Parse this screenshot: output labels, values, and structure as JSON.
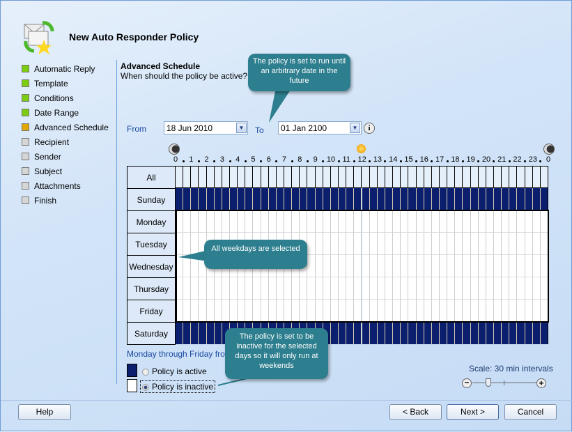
{
  "window": {
    "title": "New Auto Responder Policy"
  },
  "sidebar": {
    "items": [
      {
        "label": "Automatic Reply",
        "status": "complete"
      },
      {
        "label": "Template",
        "status": "complete"
      },
      {
        "label": "Conditions",
        "status": "complete"
      },
      {
        "label": "Date Range",
        "status": "complete"
      },
      {
        "label": "Advanced Schedule",
        "status": "current"
      },
      {
        "label": "Recipient",
        "status": "pending"
      },
      {
        "label": "Sender",
        "status": "pending"
      },
      {
        "label": "Subject",
        "status": "pending"
      },
      {
        "label": "Attachments",
        "status": "pending"
      },
      {
        "label": "Finish",
        "status": "pending"
      }
    ]
  },
  "status_colors": {
    "complete": "#7ccc10",
    "current": "#e0a800",
    "pending": "#d6d6d6"
  },
  "section": {
    "title": "Advanced Schedule",
    "subtitle": "When should the policy be active?"
  },
  "dates": {
    "from_label": "From",
    "from_value": "18 Jun  2010",
    "to_label": "To",
    "to_value": "01 Jan  2100",
    "info_icon": "info-icon"
  },
  "schedule": {
    "hour_labels": [
      "0",
      "1",
      "2",
      "3",
      "4",
      "5",
      "6",
      "7",
      "8",
      "9",
      "10",
      "11",
      "12",
      "13",
      "14",
      "15",
      "16",
      "17",
      "18",
      "19",
      "20",
      "21",
      "22",
      "23",
      "0"
    ],
    "all_label": "All",
    "days": [
      {
        "label": "Sunday",
        "selected": true
      },
      {
        "label": "Monday",
        "selected": false
      },
      {
        "label": "Tuesday",
        "selected": false
      },
      {
        "label": "Wednesday",
        "selected": false
      },
      {
        "label": "Thursday",
        "selected": false
      },
      {
        "label": "Friday",
        "selected": false
      },
      {
        "label": "Saturday",
        "selected": true
      }
    ],
    "selected_color": "#0c1f6e",
    "summary": "Monday through Friday from 0"
  },
  "legend": {
    "active_label": "Policy is active",
    "inactive_label": "Policy is inactive",
    "selected": "inactive"
  },
  "scale": {
    "label": "Scale: 30 min intervals",
    "level": 0.25
  },
  "callouts": {
    "to_date": "The policy is set to run until an arbitrary date in the future",
    "weekdays": "All weekdays are selected",
    "inactive": "The policy is set to be inactive for the selected days so it will only run at weekends"
  },
  "buttons": {
    "help": "Help",
    "back": "< Back",
    "next": "Next >",
    "cancel": "Cancel"
  }
}
